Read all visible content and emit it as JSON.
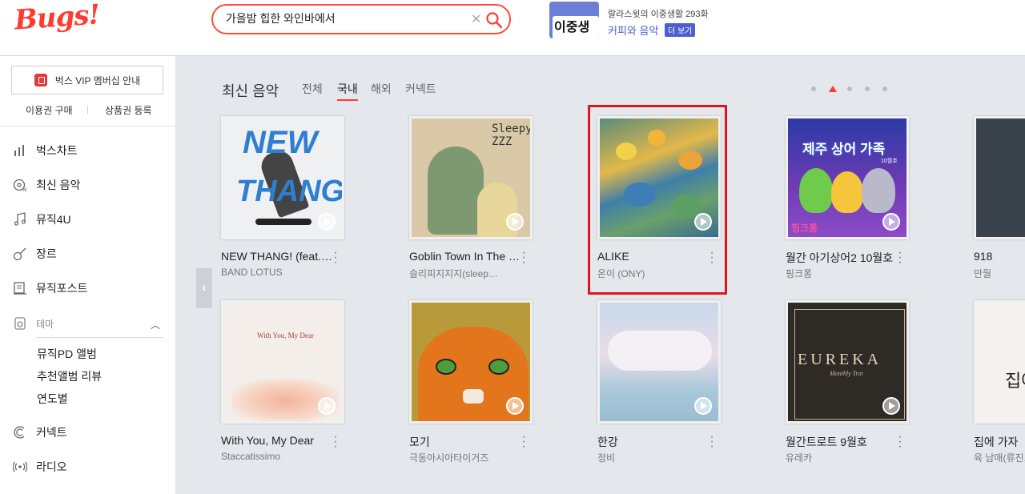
{
  "app": {
    "logo": "Bugs!"
  },
  "search": {
    "value": "가을밤 힙한 와인바에서"
  },
  "promo": {
    "image_text": "이중생활",
    "line1": "랄라스윗의 이중생활 293화",
    "line2": "커피와 음악",
    "badge": "더 보기"
  },
  "sidebar": {
    "vip_label": "벅스 VIP 멤버십 안내",
    "buy_label": "이용권 구매",
    "coupon_label": "상품권 등록",
    "items": [
      {
        "label": "벅스차트"
      },
      {
        "label": "최신 음악"
      },
      {
        "label": "뮤직4U"
      },
      {
        "label": "장르"
      },
      {
        "label": "뮤직포스트"
      },
      {
        "label": "테마"
      },
      {
        "label": "커넥트"
      },
      {
        "label": "라디오"
      }
    ],
    "theme_sub": [
      {
        "label": "뮤직PD 앨범"
      },
      {
        "label": "추천앨범 리뷰"
      },
      {
        "label": "연도별"
      }
    ]
  },
  "section": {
    "title": "최신 음악",
    "tabs": [
      "전체",
      "국내",
      "해외",
      "커넥트"
    ],
    "active_tab": "국내",
    "page_indicator": {
      "count": 5,
      "active": 2
    }
  },
  "albums": [
    {
      "title": "NEW THANG! (feat. …",
      "artist": "BAND LOTUS",
      "art_text": [
        "NEW",
        "THANG"
      ]
    },
    {
      "title": "Goblin Town In The …",
      "artist": "슬리피지지지(sleep…",
      "art_text": [
        "Sleepy",
        "ZZZ"
      ]
    },
    {
      "title": "ALIKE",
      "artist": "온이 (ONY)",
      "selected": true
    },
    {
      "title": "월간 아기상어2 10월호",
      "artist": "핑크퐁",
      "art_text": [
        "제주 상어 가족",
        "10월호",
        "핑크퐁"
      ]
    },
    {
      "title": "918",
      "artist": "만월"
    },
    {
      "title": "With You, My Dear",
      "artist": "Staccatissimo",
      "art_text": [
        "With You, My Dear"
      ]
    },
    {
      "title": "모기",
      "artist": "극동아시아타이거즈"
    },
    {
      "title": "한강",
      "artist": "정비"
    },
    {
      "title": "월간트로트 9월호",
      "artist": "유레카",
      "art_text": [
        "EUREKA",
        "Monthly Trot"
      ]
    },
    {
      "title": "집에 가자",
      "artist": "육 남매(류진,",
      "art_text": [
        "집에"
      ]
    }
  ],
  "colors": {
    "accent": "#ff3b30",
    "highlight": "#e0141e",
    "main_bg": "#e4e7ec",
    "promo": "#4b5fd0"
  }
}
